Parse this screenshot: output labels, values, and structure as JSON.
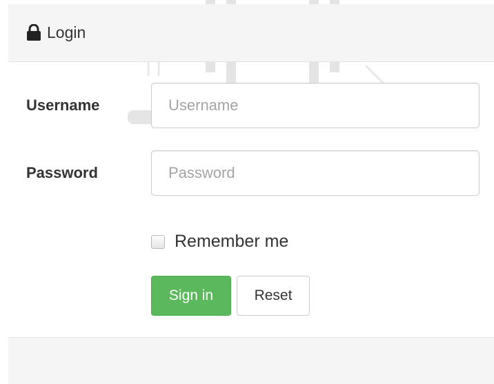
{
  "panel": {
    "heading_title": "Login",
    "heading_icon": "lock-icon"
  },
  "form": {
    "username_label": "Username",
    "username_placeholder": "Username",
    "username_value": "",
    "password_label": "Password",
    "password_placeholder": "Password",
    "password_value": "",
    "remember_label": "Remember me",
    "remember_checked": false
  },
  "buttons": {
    "signin_label": "Sign in",
    "reset_label": "Reset"
  },
  "colors": {
    "signin_bg": "#5cb85c",
    "panel_bg": "#f5f5f5",
    "border": "#cccccc"
  }
}
